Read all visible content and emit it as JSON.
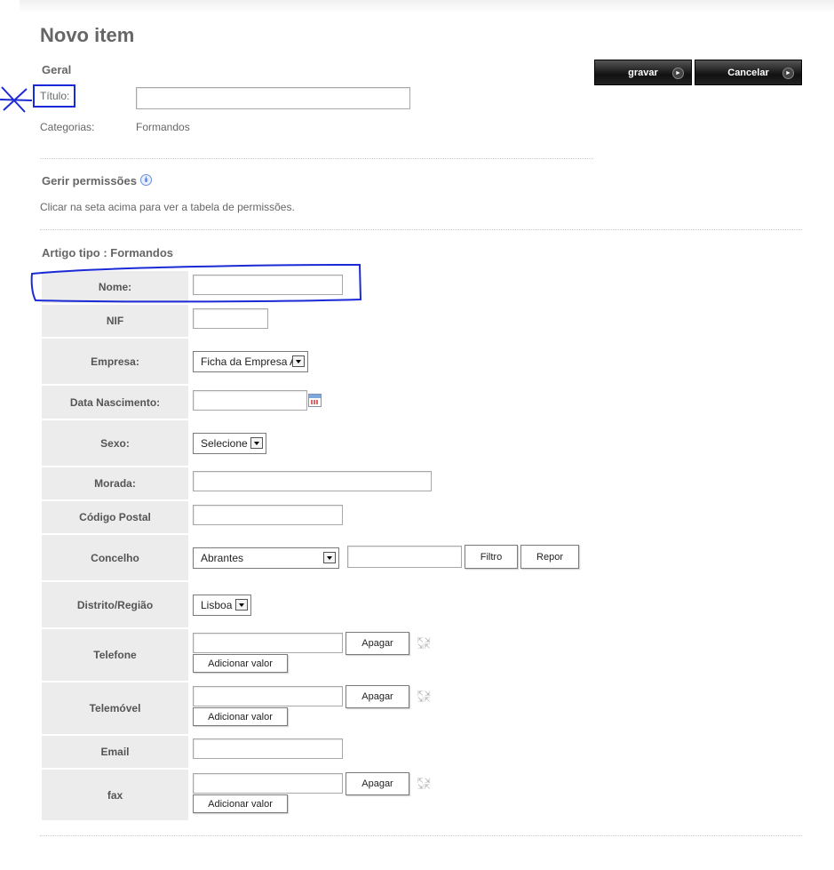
{
  "page": {
    "title": "Novo item"
  },
  "actions": {
    "save_label": "gravar",
    "cancel_label": "Cancelar"
  },
  "geral": {
    "section_title": "Geral",
    "titulo_label": "Título:",
    "titulo_value": "",
    "categorias_label": "Categorias:",
    "categorias_value": "Formandos"
  },
  "permissions": {
    "title": "Gerir permissões",
    "hint": "Clicar na seta acima para ver a tabela de permissões."
  },
  "article": {
    "title": "Artigo tipo : Formandos",
    "fields": {
      "nome": "Nome:",
      "nif": "NIF",
      "empresa": "Empresa:",
      "data_nascimento": "Data Nascimento:",
      "sexo": "Sexo:",
      "morada": "Morada:",
      "codigo_postal": "Código Postal",
      "concelho": "Concelho",
      "distrito": "Distrito/Região",
      "telefone": "Telefone",
      "telemovel": "Telemóvel",
      "email": "Email",
      "fax": "fax"
    },
    "empresa_selected": "Ficha da Empresa A",
    "sexo_selected": "Selecione",
    "concelho_selected": "Abrantes",
    "distrito_selected": "Lisboa",
    "filter_label": "Filtro",
    "reset_label": "Repor",
    "delete_label": "Apagar",
    "add_value_label": "Adicionar valor"
  },
  "colors": {
    "annotation": "#1a2ad6",
    "label_bg": "#ececec"
  }
}
